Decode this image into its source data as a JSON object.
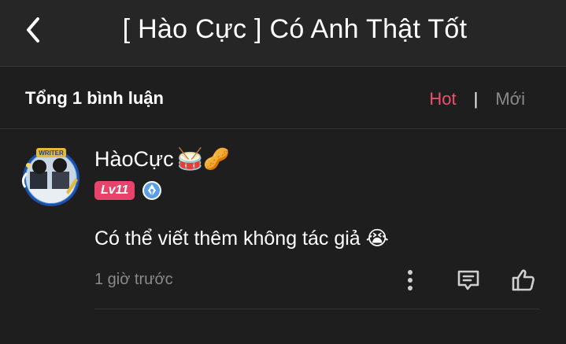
{
  "header": {
    "title": "[ Hào Cực ] Có Anh Thật Tốt"
  },
  "comments_bar": {
    "total_label": "Tổng 1 bình luận",
    "sort_hot": "Hot",
    "separator": "|",
    "sort_new": "Mới"
  },
  "comment": {
    "username": "HàoCực",
    "username_emojis": "🥁🥜",
    "level": "Lv11",
    "avatar_badge_text": "WRITER",
    "text": "Có thể viết thêm không tác giả 😭",
    "time": "1 giờ trước"
  },
  "colors": {
    "accent": "#f0506e",
    "level_badge": "#e8436a",
    "muted": "#8a8a8a",
    "background": "#1e1e1e",
    "header_bg": "#262626"
  },
  "icons": [
    "back-arrow-icon",
    "pen-nib-badge-icon",
    "more-vertical-icon",
    "reply-comment-icon",
    "thumbs-up-icon"
  ]
}
